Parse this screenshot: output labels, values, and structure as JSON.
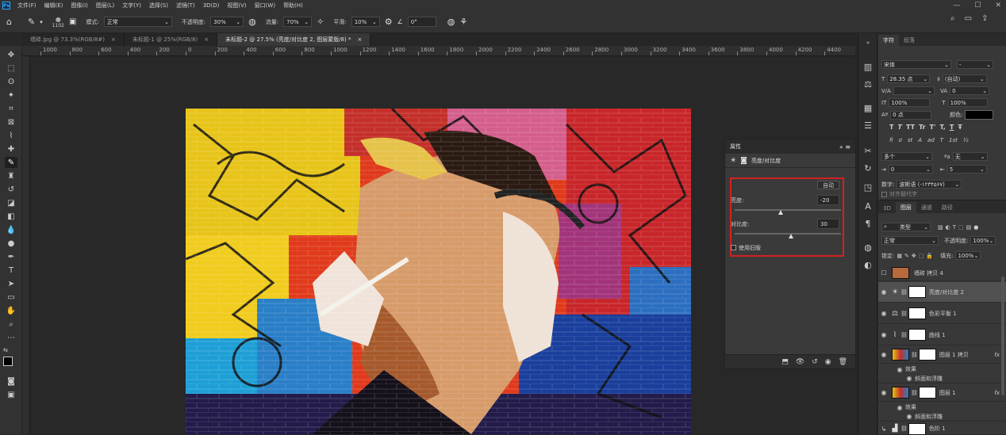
{
  "menubar": {
    "logo": "Ps",
    "items": [
      "文件(F)",
      "编辑(E)",
      "图像(I)",
      "图层(L)",
      "文字(Y)",
      "选择(S)",
      "滤镜(T)",
      "3D(D)",
      "视图(V)",
      "窗口(W)",
      "帮助(H)"
    ],
    "win_min": "—",
    "win_max": "☐",
    "win_close": "✕"
  },
  "options": {
    "brush_size": "1102",
    "mode_label": "模式:",
    "mode_value": "正常",
    "opacity_label": "不透明度:",
    "opacity_value": "30%",
    "flow_label": "流量:",
    "flow_value": "70%",
    "smooth_label": "平滑:",
    "smooth_value": "10%",
    "angle_value": "0°"
  },
  "tabs": [
    {
      "label": "墙砖.jpg @ 73.3%(RGB/8#)",
      "close": "×"
    },
    {
      "label": "未标题-1 @ 25%(RGB/8)",
      "close": "×"
    },
    {
      "label": "未标题-2 @ 27.5% (亮度/对比度 2, 图层蒙版/8) *",
      "close": "×"
    }
  ],
  "ruler_ticks": [
    "1000",
    "800",
    "600",
    "400",
    "200",
    "0",
    "200",
    "400",
    "600",
    "800",
    "1000",
    "1200",
    "1400",
    "1600",
    "1800",
    "2000",
    "2200",
    "2400",
    "2600",
    "2800",
    "3000",
    "3200",
    "3400",
    "3600",
    "3800",
    "4000",
    "4200",
    "4400"
  ],
  "properties": {
    "title": "属性",
    "subtitle": "亮度/对比度",
    "auto_label": "自动",
    "brightness_label": "亮度:",
    "brightness_value": "-20",
    "contrast_label": "对比度:",
    "contrast_value": "30",
    "legacy_label": "使用旧版",
    "brightness": -20,
    "contrast": 30
  },
  "character": {
    "tab_char": "字符",
    "tab_para": "段落",
    "font_family": "宋体",
    "font_style": "-",
    "size": "28.35 点",
    "leading": "(自动)",
    "kerning": "",
    "tracking": "0",
    "vscale": "100%",
    "hscale": "100%",
    "baseline": "0 点",
    "color_label": "颜色:",
    "typo_buttons": [
      "T",
      "T",
      "TT",
      "Tr",
      "T'",
      "T,",
      "T",
      "Ŧ"
    ],
    "extra_buttons": [
      "fi",
      "ơ",
      "st",
      "A",
      "ad",
      "T",
      "1st",
      "½"
    ],
    "lang": "多个",
    "aa": "无",
    "indent1": "0",
    "indent2": "5",
    "numbers_label": "数字:",
    "numbers_value": "波斯语 (-۱۲۳۴۵۶۷)",
    "align_label": "对齐替代字"
  },
  "layers": {
    "tabs": [
      "3D",
      "图层",
      "通道",
      "路径"
    ],
    "filter_label": "类型",
    "blend_mode": "正常",
    "opacity_label": "不透明度:",
    "opacity_value": "100%",
    "lock_label": "锁定:",
    "fill_label": "填充:",
    "fill_value": "100%",
    "items": [
      {
        "name": "墙砖 拷贝 4"
      },
      {
        "name": "亮度/对比度 2"
      },
      {
        "name": "色彩平衡 1"
      },
      {
        "name": "曲线 1"
      },
      {
        "name": "图层 1 拷贝",
        "fx": "fx"
      },
      {
        "name": "效果"
      },
      {
        "name": "斜面和浮雕"
      },
      {
        "name": "图层 1",
        "fx": "fx"
      },
      {
        "name": "效果"
      },
      {
        "name": "斜面和浮雕"
      },
      {
        "name": "色阶 1"
      }
    ]
  }
}
